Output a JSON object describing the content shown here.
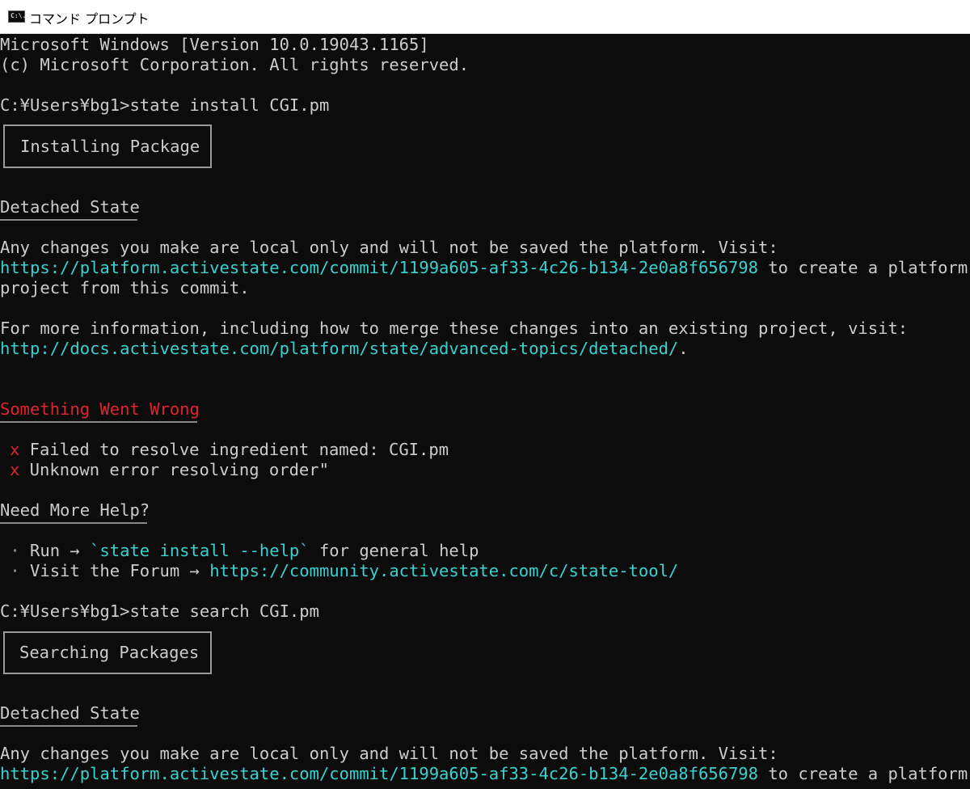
{
  "window": {
    "title": "コマンド プロンプト",
    "icon": "C:\\."
  },
  "console": {
    "version_line": "Microsoft Windows [Version 10.0.19043.1165]",
    "copyright_line": "(c) Microsoft Corporation. All rights reserved.",
    "cmd1": "C:¥Users¥bg1>state install CGI.pm",
    "box1": "Installing Package",
    "detached1": {
      "heading": "Detached State",
      "line1": "Any changes you make are local only and will not be saved the platform. Visit:",
      "link": "https://platform.activestate.com/commit/1199a605-af33-4c26-b134-2e0a8f656798",
      "link_suffix": " to create a platform",
      "line3": "project from this commit.",
      "info": "For more information, including how to merge these changes into an existing project, visit:",
      "docs_link": "http://docs.activestate.com/platform/state/advanced-topics/detached/",
      "docs_suffix": "."
    },
    "error": {
      "heading": "Something Went Wrong",
      "mark": "x",
      "item1": " Failed to resolve ingredient named: CGI.pm",
      "item2": " Unknown error resolving order\""
    },
    "help": {
      "heading": "Need More Help?",
      "bullet": " ·",
      "run_prefix": " Run → ",
      "run_cmd": "`state install --help`",
      "run_suffix": " for general help",
      "visit_prefix": " Visit the Forum → ",
      "forum_link": "https://community.activestate.com/c/state-tool/"
    },
    "cmd2": "C:¥Users¥bg1>state search CGI.pm",
    "box2": "Searching Packages",
    "detached2": {
      "heading": "Detached State",
      "line1": "Any changes you make are local only and will not be saved the platform. Visit:",
      "link": "https://platform.activestate.com/commit/1199a605-af33-4c26-b134-2e0a8f656798",
      "link_suffix": " to create a platform"
    }
  }
}
